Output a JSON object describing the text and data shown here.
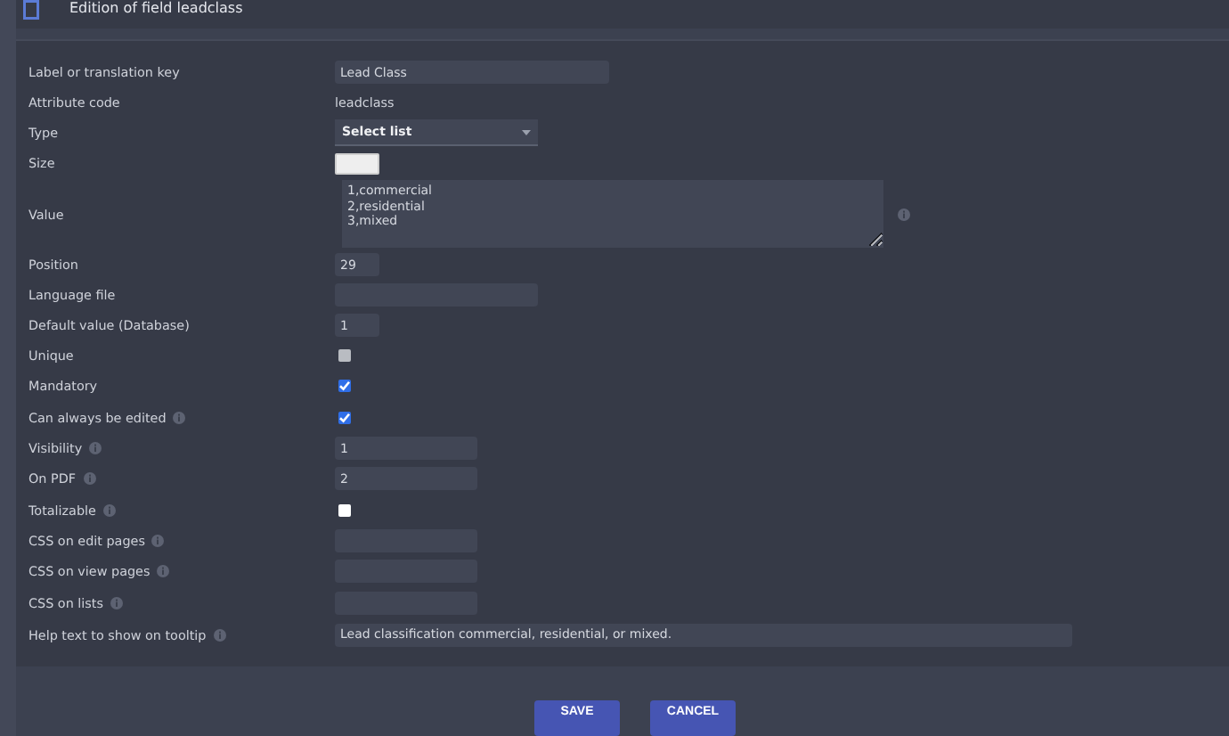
{
  "header": {
    "title": "Edition of field leadclass"
  },
  "fields": [
    {
      "label": "Label or translation key",
      "kind": "text",
      "value": "Lead Class",
      "info": false
    },
    {
      "label": "Attribute code",
      "kind": "static",
      "value": "leadclass",
      "info": false
    },
    {
      "label": "Type",
      "kind": "select",
      "value": "Select list",
      "info": false
    },
    {
      "label": "Size",
      "kind": "swatch",
      "info": false
    },
    {
      "label": "Value",
      "kind": "textarea",
      "value": "1,commercial\n2,residential\n3,mixed",
      "info": true
    },
    {
      "label": "Position",
      "kind": "text",
      "value": "29",
      "info": false
    },
    {
      "label": "Language file",
      "kind": "text",
      "info": false
    },
    {
      "label": "Default value (Database)",
      "kind": "text",
      "value": "1",
      "info": false
    },
    {
      "label": "Unique",
      "kind": "checkbox",
      "checked": false,
      "disabled": true,
      "info": false
    },
    {
      "label": "Mandatory",
      "kind": "checkbox",
      "checked": true,
      "disabled": false,
      "info": false
    },
    {
      "label": "Can always be edited",
      "kind": "checkbox",
      "checked": true,
      "disabled": false,
      "info": true
    },
    {
      "label": "Visibility",
      "kind": "text",
      "value": "1",
      "info": true
    },
    {
      "label": "On PDF",
      "kind": "text",
      "value": "2",
      "info": true
    },
    {
      "label": "Totalizable",
      "kind": "checkbox",
      "checked": false,
      "disabled": false,
      "info": true
    },
    {
      "label": "CSS on edit pages",
      "kind": "text",
      "info": true
    },
    {
      "label": "CSS on view pages",
      "kind": "text",
      "info": true
    },
    {
      "label": "CSS on lists",
      "kind": "text",
      "info": true
    },
    {
      "label": "Help text to show on tooltip",
      "kind": "text",
      "value": "Lead classification commercial, residential, or mixed.",
      "info": true
    }
  ],
  "buttons": [
    "SAVE",
    "CANCEL"
  ]
}
